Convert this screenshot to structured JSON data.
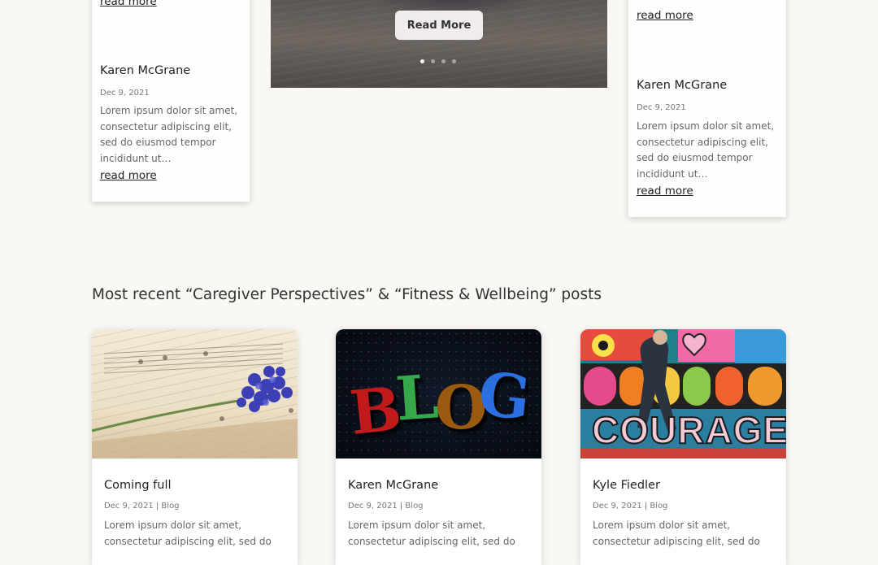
{
  "top_cards": {
    "left": {
      "top_read_more": "read more",
      "author": "Karen McGrane",
      "date": "Dec 9, 2021",
      "excerpt": "Lorem ipsum dolor sit amet, consectetur adipiscing elit, sed do eiusmod tempor incididunt ut…",
      "read_more": "read more"
    },
    "right": {
      "top_read_more": "read more",
      "author": "Karen McGrane",
      "date": "Dec 9, 2021",
      "excerpt": "Lorem ipsum dolor sit amet, consectetur adipiscing elit, sed do eiusmod tempor incididunt ut…",
      "read_more": "read more"
    }
  },
  "slider": {
    "button_label": "Read More",
    "slide_count": 4,
    "active_slide": 1
  },
  "section": {
    "title": "Most recent “Caregiver Perspectives” & “Fitness & Wellbeing” posts"
  },
  "posts": [
    {
      "image_icon": "flower-on-sheet-music",
      "title": "Coming full",
      "meta": "Dec 9, 2021 | Blog",
      "excerpt": "Lorem ipsum dolor sit amet, consectetur adipiscing elit, sed do"
    },
    {
      "image_icon": "blog-3d-letters",
      "blog_letters": [
        "B",
        "L",
        "O",
        "G"
      ],
      "title": "Karen McGrane",
      "meta": "Dec 9, 2021 | Blog",
      "excerpt": "Lorem ipsum dolor sit amet, consectetur adipiscing elit, sed do"
    },
    {
      "image_icon": "courage-graffiti-wall",
      "graffiti_word": "COURAGE",
      "title": "Kyle Fiedler",
      "meta": "Dec 9, 2021 | Blog",
      "excerpt": "Lorem ipsum dolor sit amet, consectetur adipiscing elit, sed do"
    }
  ],
  "colors": {
    "page_background": "#faf8f5",
    "card_background": "#ffffff",
    "heading_text": "#333333",
    "muted_text": "#777777",
    "slider_button": "#efeceb"
  }
}
